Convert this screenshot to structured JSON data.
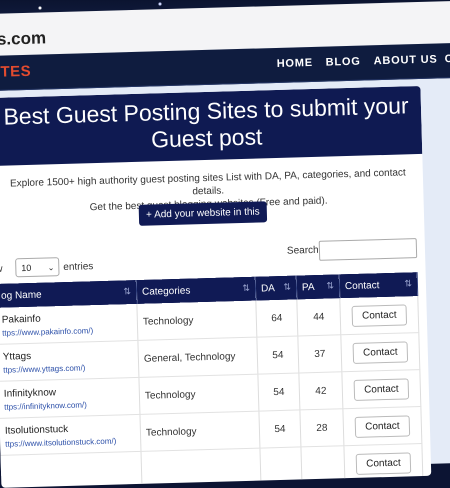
{
  "browser": {
    "domain": "s.com"
  },
  "nav": {
    "brand": "ITES",
    "links": [
      "HOME",
      "BLOG",
      "ABOUT US",
      "C"
    ]
  },
  "header": {
    "title": "Best Guest Posting Sites to submit your Guest post"
  },
  "intro": {
    "line1": "Explore 1500+ high authority guest posting sites List with DA, PA, categories, and contact details.",
    "line2": "Get the best guest blogging websites (Free and paid)."
  },
  "add_button": "+ Add your website in this list",
  "controls": {
    "show_label": "w",
    "show_value": "10",
    "entries_label": "entries",
    "search_label": "Search:"
  },
  "table": {
    "headers": [
      "og Name",
      "Categories",
      "DA",
      "PA",
      "Contact"
    ],
    "rows": [
      {
        "name": "Pakainfo",
        "url": "ttps://www.pakainfo.com/)",
        "category": "Technology",
        "da": "64",
        "pa": "44",
        "contact": "Contact"
      },
      {
        "name": "Yttags",
        "url": "ttps://www.yttags.com/)",
        "category": "General, Technology",
        "da": "54",
        "pa": "37",
        "contact": "Contact"
      },
      {
        "name": "Infinityknow",
        "url": "ttps://infinityknow.com/)",
        "category": "Technology",
        "da": "54",
        "pa": "42",
        "contact": "Contact"
      },
      {
        "name": "Itsolutionstuck",
        "url": "ttps://www.itsolutionstuck.com/)",
        "category": "Technology",
        "da": "54",
        "pa": "28",
        "contact": "Contact"
      },
      {
        "name": "",
        "url": "",
        "category": "",
        "da": "",
        "pa": "",
        "contact": "Contact"
      }
    ]
  }
}
